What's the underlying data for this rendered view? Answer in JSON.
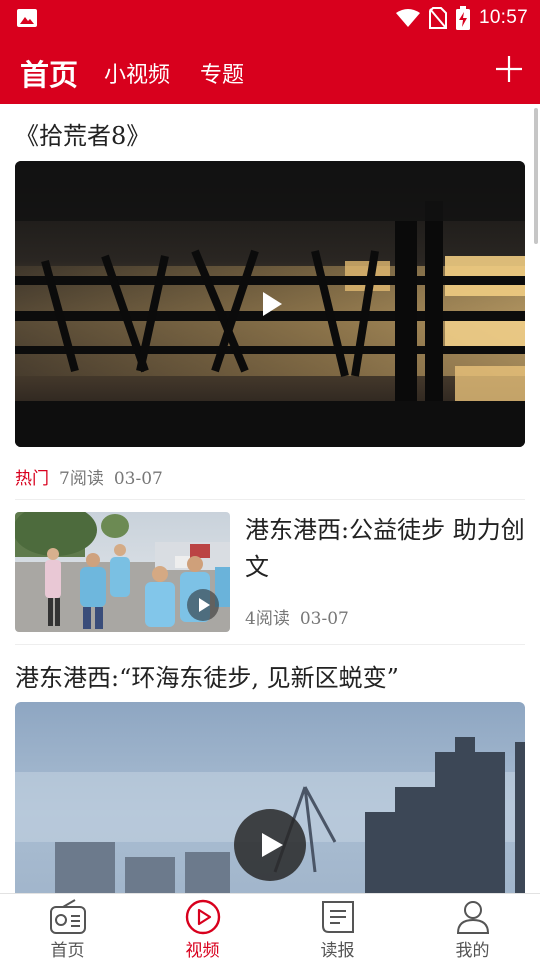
{
  "status_bar": {
    "time": "10:57",
    "icons": [
      "image-icon",
      "wifi-icon",
      "no-sim-icon",
      "battery-charging-icon"
    ]
  },
  "header": {
    "tabs": [
      {
        "label": "首页",
        "active": true
      },
      {
        "label": "小视频",
        "active": false
      },
      {
        "label": "专题",
        "active": false
      }
    ],
    "add_icon": "plus-icon"
  },
  "feed": {
    "items": [
      {
        "type": "large",
        "title": "《拾荒者8》",
        "tag": "热门",
        "reads": "7阅读",
        "date": "03-07"
      },
      {
        "type": "small",
        "title": "港东港西:公益徒步 助力创文",
        "reads": "4阅读",
        "date": "03-07"
      },
      {
        "type": "large",
        "title": "港东港西:“环海东徒步, 见新区蜕变”"
      }
    ]
  },
  "bottom_nav": {
    "tabs": [
      {
        "label": "首页",
        "icon": "radio-icon",
        "active": false
      },
      {
        "label": "视频",
        "icon": "play-circle-icon",
        "active": true
      },
      {
        "label": "读报",
        "icon": "newspaper-icon",
        "active": false
      },
      {
        "label": "我的",
        "icon": "user-icon",
        "active": false
      }
    ]
  },
  "colors": {
    "brand_red": "#d8001d",
    "text_dark": "#222222",
    "text_meta": "#777777",
    "tab_inactive": "#555555"
  }
}
